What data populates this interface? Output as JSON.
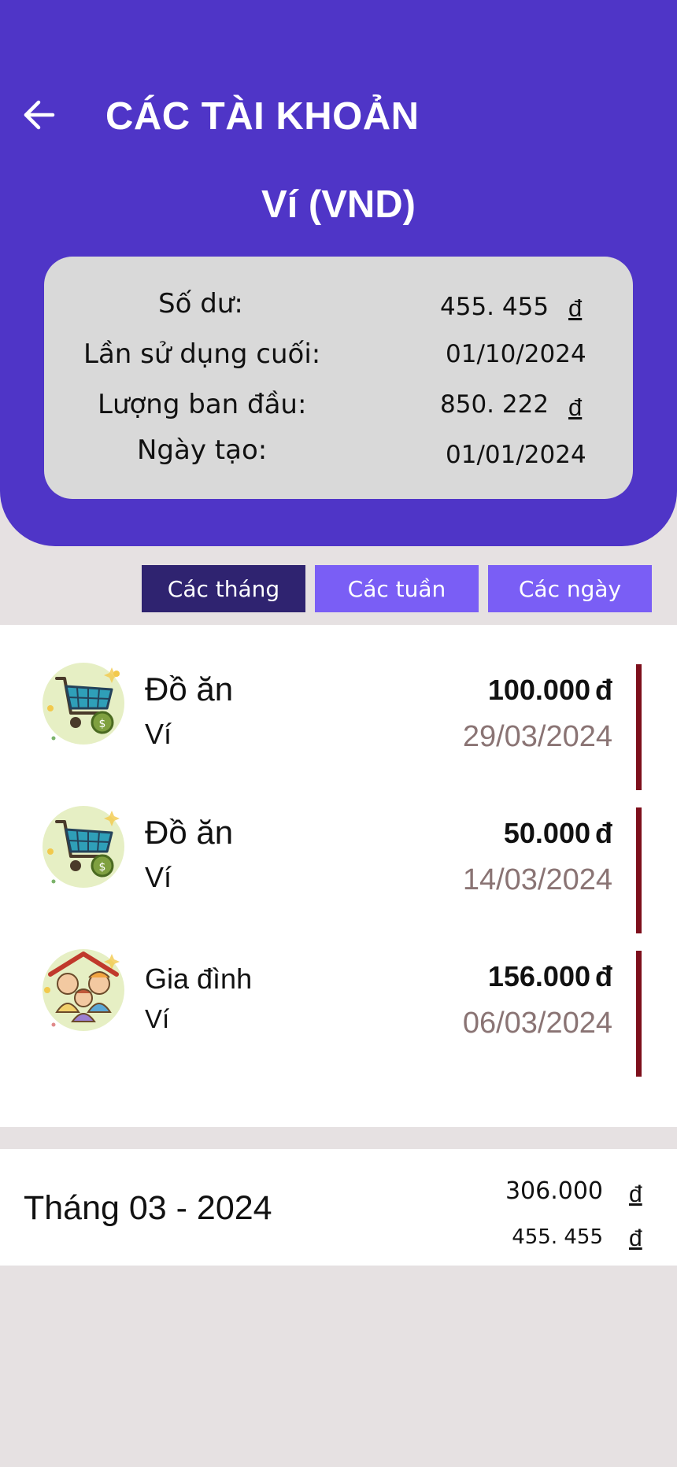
{
  "header": {
    "title": "CÁC TÀI KHOẢN",
    "wallet": "Ví (VND)",
    "bg_color": "#4f35c7"
  },
  "info": {
    "balance_label": "Số dư:",
    "balance_value": "455. 455",
    "balance_currency": "đ",
    "last_used_label": "Lần sử dụng cuối:",
    "last_used_value": "01/10/2024",
    "initial_label": "Lượng ban đầu:",
    "initial_value": "850. 222",
    "initial_currency": "đ",
    "created_label": "Ngày tạo:",
    "created_value": "01/01/2024"
  },
  "tabs": [
    {
      "label": "Các tháng",
      "active": true
    },
    {
      "label": "Các tuần",
      "active": false
    },
    {
      "label": "Các ngày",
      "active": false
    }
  ],
  "transactions": [
    {
      "category": "Đồ ăn",
      "account": "Ví",
      "amount": "100.000",
      "currency": "đ",
      "date": "29/03/2024",
      "icon": "shopping-cart-icon"
    },
    {
      "category": "Đồ ăn",
      "account": "Ví",
      "amount": "50.000",
      "currency": "đ",
      "date": "14/03/2024",
      "icon": "shopping-cart-icon"
    },
    {
      "category": "Gia đình",
      "account": "Ví",
      "amount": "156.000",
      "currency": "đ",
      "date": "06/03/2024",
      "icon": "family-icon"
    }
  ],
  "summary": {
    "month": "Tháng 03 - 2024",
    "total_spent": "306.000",
    "total_spent_currency": "đ",
    "balance": "455. 455",
    "balance_currency": "đ"
  },
  "colors": {
    "accent": "#4f35c7",
    "tab_active": "#2f2370",
    "tab_inactive": "#7a5ef5",
    "expense_bar": "#7d0f1c",
    "date_text": "#8a7474"
  }
}
